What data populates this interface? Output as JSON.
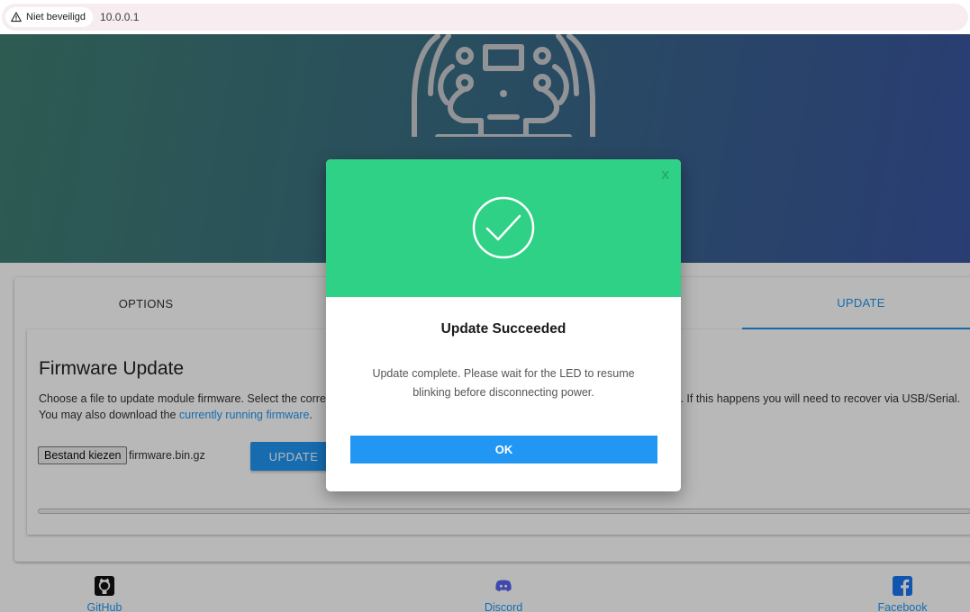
{
  "browser": {
    "security_label": "Niet beveiligd",
    "url": "10.0.0.1"
  },
  "tabs": [
    {
      "label": "OPTIONS"
    },
    {
      "label": "UPDATE",
      "active": true
    }
  ],
  "firmware": {
    "title": "Firmware Update",
    "desc_line1_visible": "Choose a file to update module firmware. Select the correc",
    "desc_line1_right": "r. If this happens you will need to recover via USB/Serial.",
    "desc_line2_prefix": "You may also download the ",
    "desc_link": "currently running firmware",
    "desc_line2_suffix": ".",
    "file_button_label": "Bestand kiezen",
    "file_name": "firmware.bin.gz",
    "update_button_label": "UPDATE"
  },
  "footer": {
    "github": "GitHub",
    "discord": "Discord",
    "facebook": "Facebook"
  },
  "modal": {
    "close_label": "X",
    "title": "Update Succeeded",
    "message": "Update complete. Please wait for the LED to resume blinking before disconnecting power.",
    "ok_label": "OK",
    "header_color": "#2ed185",
    "button_color": "#2196f3"
  },
  "icons": {
    "security": "warning-triangle-icon",
    "success": "check-circle-icon",
    "github": "github-icon",
    "discord": "discord-icon",
    "facebook": "facebook-icon",
    "logo": "circuit-logo-icon"
  }
}
